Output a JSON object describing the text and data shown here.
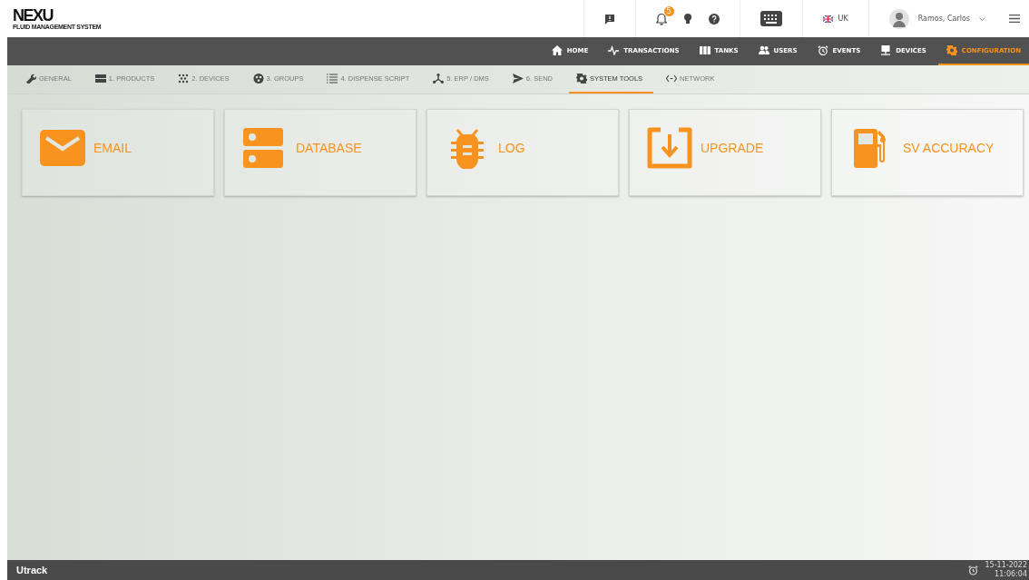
{
  "logo": {
    "name": "NEXU",
    "tagline": "FLUID MANAGEMENT SYSTEM"
  },
  "header": {
    "notifications_count": "5",
    "language": "UK",
    "user": "Ramos, Carlos"
  },
  "main_nav": [
    {
      "label": "HOME",
      "selected": false
    },
    {
      "label": "TRANSACTIONS",
      "selected": false
    },
    {
      "label": "TANKS",
      "selected": false
    },
    {
      "label": "USERS",
      "selected": false
    },
    {
      "label": "EVENTS",
      "selected": false
    },
    {
      "label": "DEVICES",
      "selected": false
    },
    {
      "label": "CONFIGURATION",
      "selected": true
    }
  ],
  "sub_nav": [
    {
      "label": "GENERAL",
      "selected": false
    },
    {
      "label": "1. PRODUCTS",
      "selected": false
    },
    {
      "label": "2. DEVICES",
      "selected": false
    },
    {
      "label": "3. GROUPS",
      "selected": false
    },
    {
      "label": "4. DISPENSE SCRIPT",
      "selected": false
    },
    {
      "label": "5. ERP / DMS",
      "selected": false
    },
    {
      "label": "6. SEND",
      "selected": false
    },
    {
      "label": "SYSTEM TOOLS",
      "selected": true
    },
    {
      "label": "NETWORK",
      "selected": false
    }
  ],
  "tools": [
    {
      "label": "EMAIL"
    },
    {
      "label": "DATABASE"
    },
    {
      "label": "LOG"
    },
    {
      "label": "UPGRADE"
    },
    {
      "label": "SV ACCURACY"
    }
  ],
  "footer": {
    "brand": "Utrack",
    "date": "15-11-2022",
    "time": "11:06:04"
  }
}
